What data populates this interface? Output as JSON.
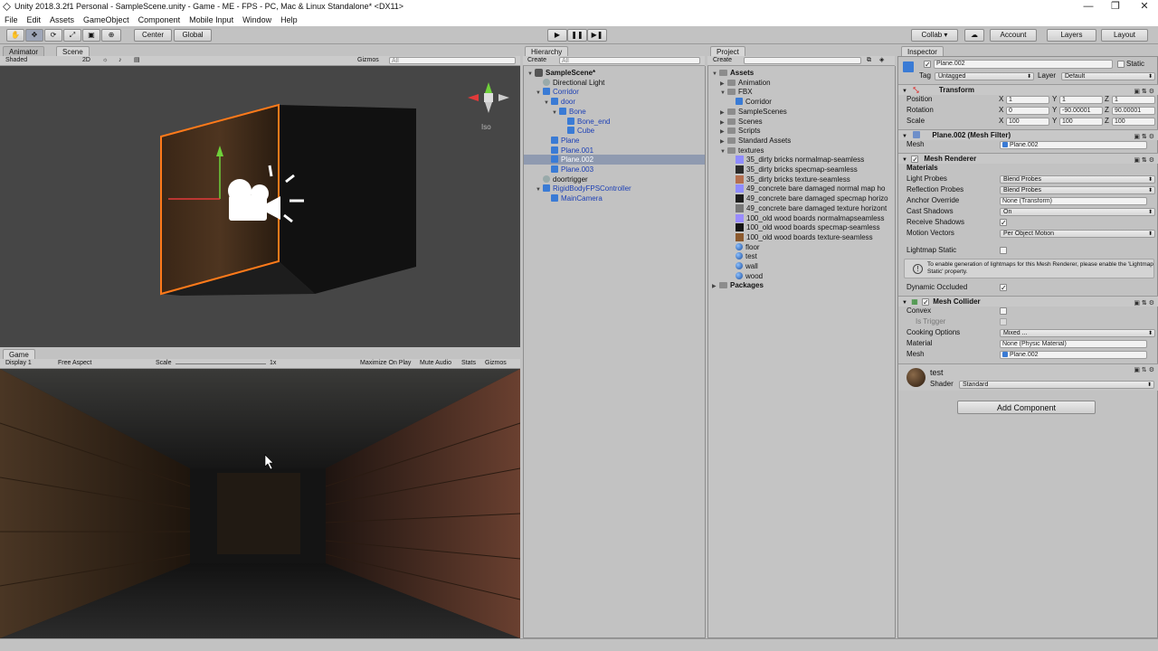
{
  "window": {
    "title": "Unity 2018.3.2f1 Personal - SampleScene.unity - Game - ME - FPS - PC, Mac & Linux Standalone* <DX11>",
    "controls": [
      "—",
      "❐",
      "✕"
    ]
  },
  "menu": [
    "File",
    "Edit",
    "Assets",
    "GameObject",
    "Component",
    "Mobile Input",
    "Window",
    "Help"
  ],
  "toolbar": {
    "tools": [
      "✋",
      "✥",
      "⟳",
      "⤢",
      "▣",
      "⊕"
    ],
    "pivot": "Center",
    "space": "Global",
    "play_controls": [
      "▶",
      "❚❚",
      "▶❚"
    ],
    "collab": "Collab ▾",
    "cloud": "☁",
    "account": "Account",
    "layers": "Layers",
    "layout": "Layout"
  },
  "scene": {
    "tabs": [
      "Animator",
      "Scene"
    ],
    "shading": "Shaded",
    "mode_2d": "2D",
    "gizmos": "Gizmos",
    "search_placeholder": "All",
    "projection": "Iso"
  },
  "game": {
    "tab": "Game",
    "display": "Display 1",
    "aspect": "Free Aspect",
    "scale_label": "Scale",
    "scale_value": "1x",
    "maximize": "Maximize On Play",
    "mute": "Mute Audio",
    "stats": "Stats",
    "gizmos": "Gizmos"
  },
  "hierarchy": {
    "tab": "Hierarchy",
    "create": "Create",
    "search_placeholder": "All",
    "items": [
      {
        "label": "SampleScene*",
        "depth": 0,
        "style": "scene"
      },
      {
        "label": "Directional Light",
        "depth": 1,
        "style": "normal"
      },
      {
        "label": "Corridor",
        "depth": 1,
        "style": "prefab"
      },
      {
        "label": "door",
        "depth": 2,
        "style": "prefab"
      },
      {
        "label": "Bone",
        "depth": 3,
        "style": "prefab"
      },
      {
        "label": "Bone_end",
        "depth": 4,
        "style": "prefab"
      },
      {
        "label": "Cube",
        "depth": 4,
        "style": "prefab"
      },
      {
        "label": "Plane",
        "depth": 2,
        "style": "prefab"
      },
      {
        "label": "Plane.001",
        "depth": 2,
        "style": "prefab"
      },
      {
        "label": "Plane.002",
        "depth": 2,
        "style": "selected"
      },
      {
        "label": "Plane.003",
        "depth": 2,
        "style": "prefab"
      },
      {
        "label": "doortrigger",
        "depth": 1,
        "style": "normal"
      },
      {
        "label": "RigidBodyFPSController",
        "depth": 1,
        "style": "prefab"
      },
      {
        "label": "MainCamera",
        "depth": 2,
        "style": "prefab"
      }
    ]
  },
  "project": {
    "tab": "Project",
    "create": "Create",
    "items": [
      {
        "label": "Assets",
        "depth": 0,
        "kind": "folder",
        "bold": true
      },
      {
        "label": "Animation",
        "depth": 1,
        "kind": "folder"
      },
      {
        "label": "FBX",
        "depth": 1,
        "kind": "folder"
      },
      {
        "label": "Corridor",
        "depth": 2,
        "kind": "prefab"
      },
      {
        "label": "SampleScenes",
        "depth": 1,
        "kind": "folder"
      },
      {
        "label": "Scenes",
        "depth": 1,
        "kind": "folder"
      },
      {
        "label": "Scripts",
        "depth": 1,
        "kind": "folder"
      },
      {
        "label": "Standard Assets",
        "depth": 1,
        "kind": "folder"
      },
      {
        "label": "textures",
        "depth": 1,
        "kind": "folder"
      },
      {
        "label": "35_dirty bricks normalmap-seamless",
        "depth": 2,
        "kind": "tex",
        "color": "#8f8cff"
      },
      {
        "label": "35_dirty bricks specmap-seamless",
        "depth": 2,
        "kind": "tex",
        "color": "#2a2a2a"
      },
      {
        "label": "35_dirty bricks texture-seamless",
        "depth": 2,
        "kind": "tex",
        "color": "#b56f4f"
      },
      {
        "label": "49_concrete bare damaged normal map ho",
        "depth": 2,
        "kind": "tex",
        "color": "#8f8cff"
      },
      {
        "label": "49_concrete bare damaged specmap horizo",
        "depth": 2,
        "kind": "tex",
        "color": "#1c1c1c"
      },
      {
        "label": "49_concrete bare damaged texture horizont",
        "depth": 2,
        "kind": "tex",
        "color": "#777777"
      },
      {
        "label": "100_old wood boards normalmapseamless",
        "depth": 2,
        "kind": "tex",
        "color": "#9a8cff"
      },
      {
        "label": "100_old wood boards specmap-seamless",
        "depth": 2,
        "kind": "tex",
        "color": "#141414"
      },
      {
        "label": "100_old wood boards texture-seamless",
        "depth": 2,
        "kind": "tex",
        "color": "#8c5a2e"
      },
      {
        "label": "floor",
        "depth": 2,
        "kind": "mat"
      },
      {
        "label": "test",
        "depth": 2,
        "kind": "mat"
      },
      {
        "label": "wall",
        "depth": 2,
        "kind": "mat"
      },
      {
        "label": "wood",
        "depth": 2,
        "kind": "mat"
      },
      {
        "label": "Packages",
        "depth": 0,
        "kind": "folder",
        "bold": true
      }
    ]
  },
  "inspector": {
    "tab": "Inspector",
    "object_name": "Plane.002",
    "static_label": "Static",
    "tag_label": "Tag",
    "tag_value": "Untagged",
    "layer_label": "Layer",
    "layer_value": "Default",
    "transform": {
      "title": "Transform",
      "position_label": "Position",
      "rotation_label": "Rotation",
      "scale_label": "Scale",
      "axis": [
        "X",
        "Y",
        "Z"
      ],
      "position": [
        "1",
        "1",
        "1"
      ],
      "rotation": [
        "0",
        "-90.00001",
        "90.00001"
      ],
      "scale": [
        "100",
        "100",
        "100"
      ]
    },
    "mesh_filter": {
      "title": "Plane.002 (Mesh Filter)",
      "mesh_label": "Mesh",
      "mesh_value": "Plane.002"
    },
    "mesh_renderer": {
      "title": "Mesh Renderer",
      "materials": "Materials",
      "light_probes_label": "Light Probes",
      "light_probes": "Blend Probes",
      "reflection_probes_label": "Reflection Probes",
      "reflection_probes": "Blend Probes",
      "anchor_override_label": "Anchor Override",
      "anchor_override": "None (Transform)",
      "cast_shadows_label": "Cast Shadows",
      "cast_shadows": "On",
      "receive_shadows_label": "Receive Shadows",
      "motion_vectors_label": "Motion Vectors",
      "motion_vectors": "Per Object Motion",
      "lightmap_static_label": "Lightmap Static",
      "info": "To enable generation of lightmaps for this Mesh Renderer, please enable the 'Lightmap Static' property.",
      "dynamic_occluded_label": "Dynamic Occluded"
    },
    "mesh_collider": {
      "title": "Mesh Collider",
      "convex_label": "Convex",
      "is_trigger_label": "Is Trigger",
      "cooking_label": "Cooking Options",
      "cooking_value": "Mixed ...",
      "material_label": "Material",
      "material_value": "None (Physic Material)",
      "mesh_label": "Mesh",
      "mesh_value": "Plane.002"
    },
    "material": {
      "name": "test",
      "shader_label": "Shader",
      "shader_value": "Standard"
    },
    "add_component": "Add Component"
  },
  "colors": {
    "selection_orange": "#ff7a1a",
    "hierarchy_blue": "#1b3fb5",
    "selected_row": "#8f9ab0"
  }
}
